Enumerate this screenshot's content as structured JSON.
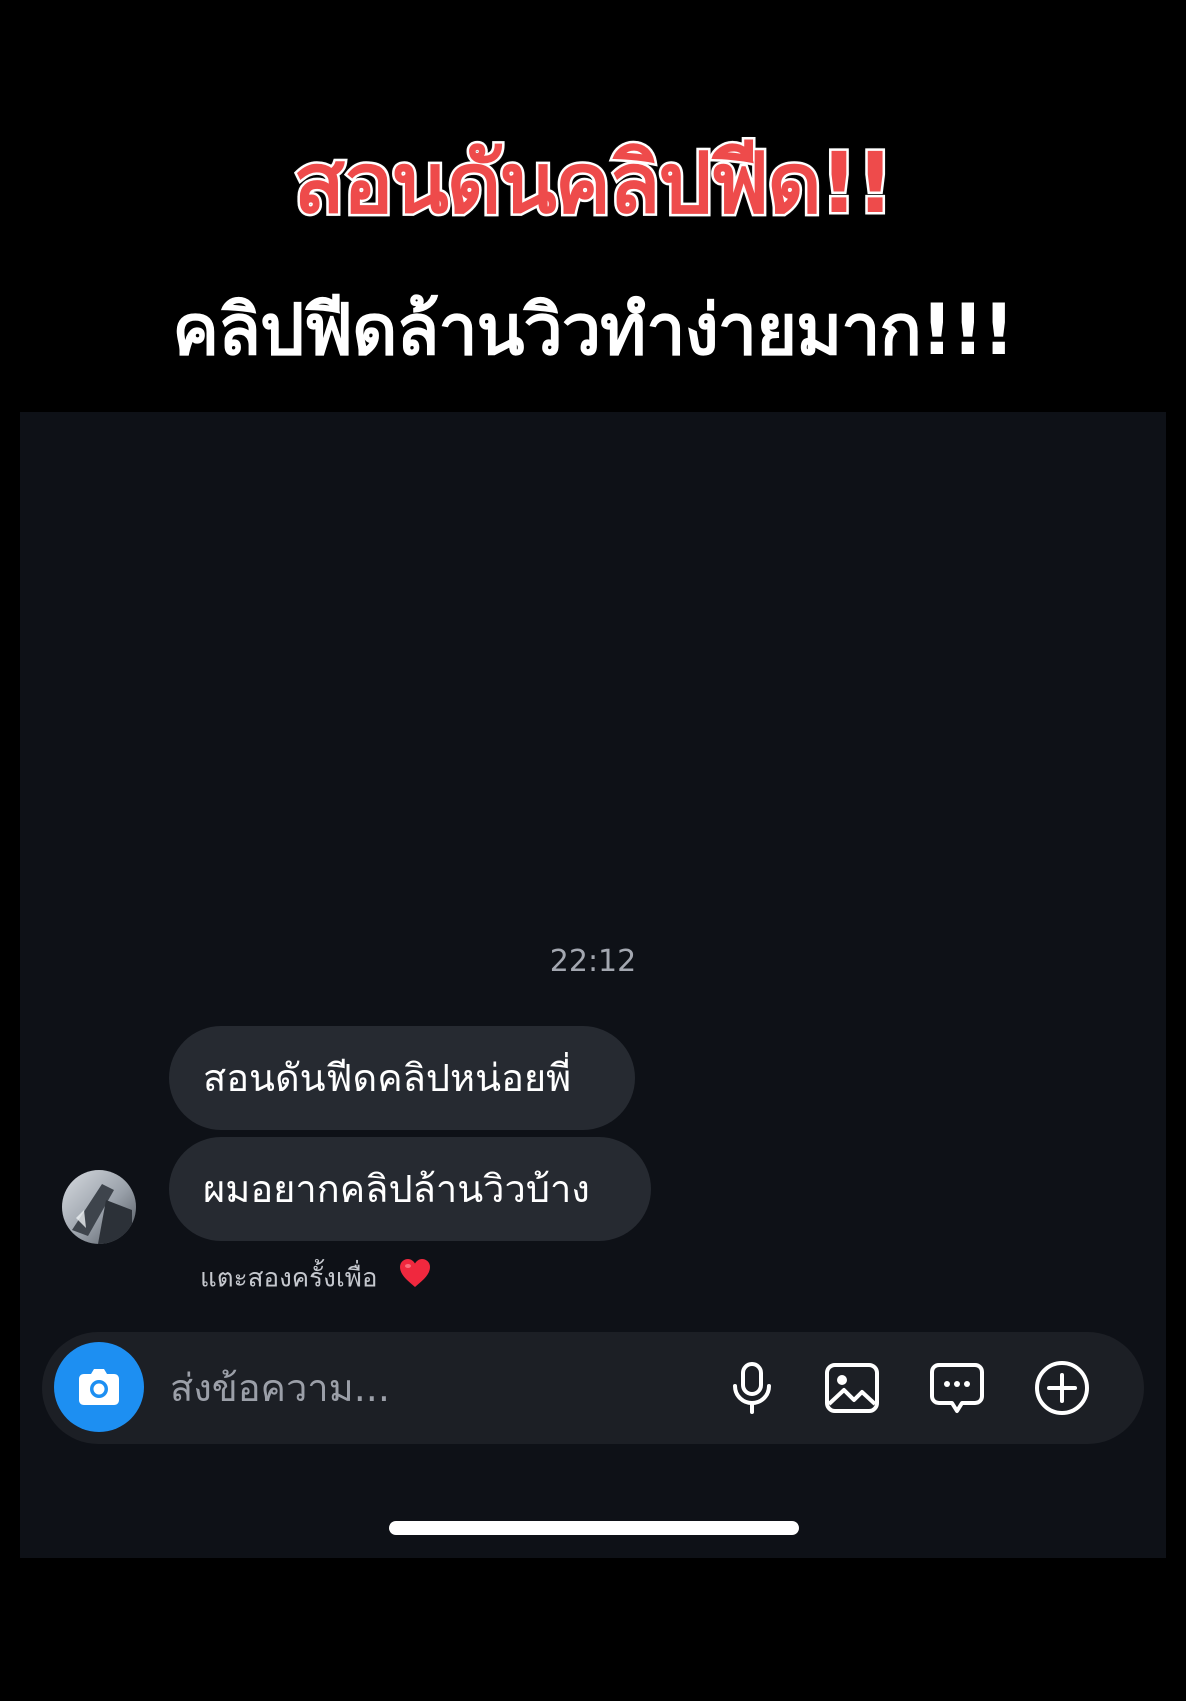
{
  "overlay": {
    "headline": "สอนดันคลิปฟีด!!",
    "subheadline": "คลิปฟีดล้านวิวทำง่ายมาก!!!"
  },
  "chat": {
    "timestamp": "22:12",
    "messages": [
      {
        "text": "สอนดันฟีดคลิปหน่อยพี่"
      },
      {
        "text": "ผมอยากคลิปล้านวิวบ้าง"
      }
    ],
    "reaction_hint": "แตะสองครั้งเพื่อ",
    "reaction_icon": "heart-icon"
  },
  "composer": {
    "placeholder": "ส่งข้อความ...",
    "icons": [
      "camera-icon",
      "microphone-icon",
      "image-icon",
      "sticker-icon",
      "plus-icon"
    ]
  },
  "colors": {
    "headline_red": "#ee4b4b",
    "screen_background": "#0e1117",
    "bubble": "#262a31",
    "camera_button": "#1d8ff2"
  }
}
